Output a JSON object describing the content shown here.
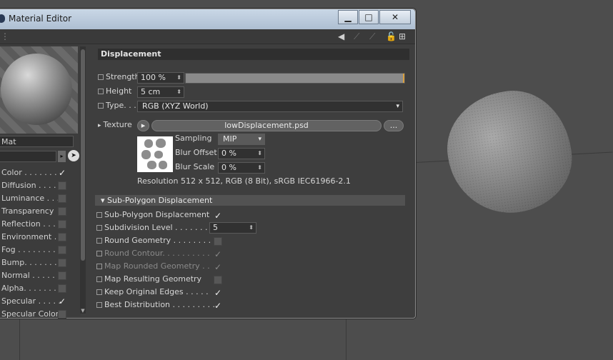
{
  "window": {
    "title": "Material Editor",
    "minimize": "▁",
    "maximize": "□",
    "close": "✕"
  },
  "left": {
    "material_name": "Mat",
    "channels": [
      {
        "label": "Color . . . . . . . .",
        "checked": true
      },
      {
        "label": "Diffusion . . . . .",
        "checked": false
      },
      {
        "label": "Luminance . . . .",
        "checked": false
      },
      {
        "label": "Transparency",
        "checked": false
      },
      {
        "label": "Reflection . . . .",
        "checked": false
      },
      {
        "label": "Environment . .",
        "checked": false
      },
      {
        "label": "Fog . . . . . . . . .",
        "checked": false
      },
      {
        "label": "Bump. . . . . . . .",
        "checked": false
      },
      {
        "label": "Normal . . . . . .",
        "checked": false
      },
      {
        "label": "Alpha. . . . . . . .",
        "checked": false
      },
      {
        "label": "Specular . . . . .",
        "checked": true
      },
      {
        "label": "Specular Color",
        "checked": false
      }
    ]
  },
  "displacement": {
    "header": "Displacement",
    "strength_label": "Strength",
    "strength_value": "100 %",
    "strength_fraction": 1.0,
    "height_label": "Height",
    "height_value": "5 cm",
    "type_label": "Type. . .",
    "type_value": "RGB (XYZ World)",
    "texture_label": "Texture",
    "texture_file": "lowDisplacement.psd",
    "texture_more": "...",
    "sampling_label": "Sampling",
    "sampling_value": "MIP",
    "blur_offset_label": "Blur Offset",
    "blur_offset_value": "0 %",
    "blur_scale_label": "Blur Scale",
    "blur_scale_value": "0 %",
    "resolution": "Resolution 512 x 512, RGB (8 Bit), sRGB IEC61966-2.1"
  },
  "subpoly": {
    "header": "Sub-Polygon Displacement",
    "rows": [
      {
        "label": "Sub-Polygon Displacement",
        "checked": true,
        "dim": false
      },
      {
        "label": "Subdivision Level . . . . . . . . .",
        "value": "5",
        "dim": false
      },
      {
        "label": "Round Geometry . . . . . . . . .",
        "checked": false,
        "dim": false
      },
      {
        "label": "Round Contour. . . . . . . . . .",
        "checked": true,
        "dim": true
      },
      {
        "label": "Map Rounded Geometry . .",
        "checked": true,
        "dim": true
      },
      {
        "label": "Map Resulting Geometry",
        "checked": false,
        "dim": false
      },
      {
        "label": "Keep Original Edges . . . . .",
        "checked": true,
        "dim": false
      },
      {
        "label": "Best Distribution . . . . . . . . .",
        "checked": true,
        "dim": false
      }
    ]
  },
  "icons": {
    "check": "✓",
    "dropdown": "▾",
    "spinner": "⬍",
    "triangle_right": "▸",
    "triangle_down": "▾"
  }
}
